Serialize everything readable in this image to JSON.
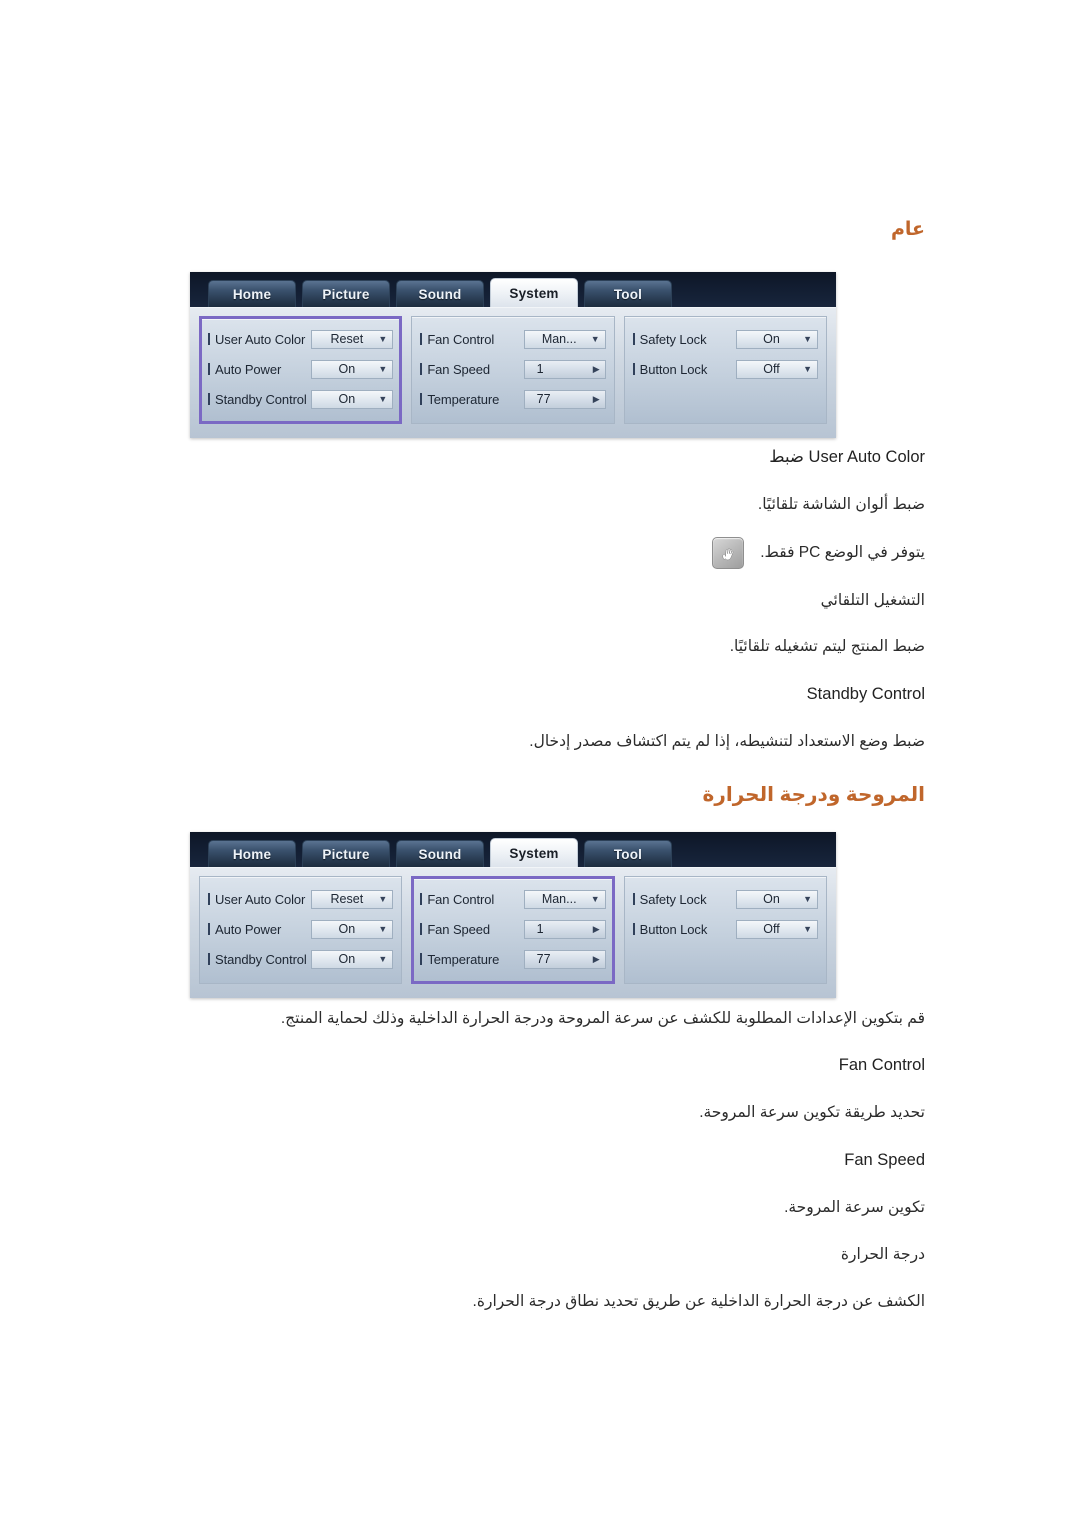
{
  "headings": {
    "general": "عام",
    "fan_temp": "المروحة ودرجة الحرارة"
  },
  "general_section": {
    "item1_title": "ضبط User Auto Color",
    "item1_desc": "ضبط ألوان الشاشة تلقائيًا.",
    "note1": "يتوفر في الوضع PC فقط.",
    "item2_title": "التشغيل التلقائي",
    "item2_desc": "ضبط المنتج ليتم تشغيله تلقائيًا.",
    "item3_title": "Standby Control",
    "item3_desc": "ضبط وضع الاستعداد لتنشيطه، إذا لم يتم اكتشاف مصدر إدخال."
  },
  "fan_section": {
    "intro": "قم بتكوين الإعدادات المطلوبة للكشف عن سرعة المروحة ودرجة الحرارة الداخلية وذلك لحماية المنتج.",
    "item1_title": "Fan Control",
    "item1_desc": "تحديد طريقة تكوين سرعة المروحة.",
    "item2_title": "Fan Speed",
    "item2_desc": "تكوين سرعة المروحة.",
    "item3_title": "درجة الحرارة",
    "item3_desc": "الكشف عن درجة الحرارة الداخلية عن طريق تحديد نطاق درجة الحرارة."
  },
  "osd": {
    "tabs": [
      {
        "label": "Home",
        "active": false
      },
      {
        "label": "Picture",
        "active": false
      },
      {
        "label": "Sound",
        "active": false
      },
      {
        "label": "System",
        "active": true
      },
      {
        "label": "Tool",
        "active": false
      }
    ],
    "columns": [
      {
        "id": "col-general",
        "rows": [
          {
            "label": "User Auto Color",
            "value": "Reset",
            "control": "dropdown"
          },
          {
            "label": "Auto Power",
            "value": "On",
            "control": "dropdown"
          },
          {
            "label": "Standby Control",
            "value": "On",
            "control": "dropdown"
          }
        ]
      },
      {
        "id": "col-fan-temp",
        "rows": [
          {
            "label": "Fan Control",
            "value": "Man...",
            "control": "dropdown"
          },
          {
            "label": "Fan Speed",
            "value": "1",
            "control": "stepper"
          },
          {
            "label": "Temperature",
            "value": "77",
            "control": "stepper"
          }
        ]
      },
      {
        "id": "col-lock",
        "rows": [
          {
            "label": "Safety Lock",
            "value": "On",
            "control": "dropdown"
          },
          {
            "label": "Button Lock",
            "value": "Off",
            "control": "dropdown"
          }
        ]
      }
    ],
    "glyphs": {
      "dropdown": "▼",
      "stepper": "▶"
    },
    "highlight_color": "#7b69c4",
    "screenshot1_highlight": "col-general",
    "screenshot2_highlight": "col-fan-temp"
  },
  "icons": {
    "note": "note-hand-icon"
  },
  "colors": {
    "heading": "#c0662b",
    "highlight": "#7b69c4",
    "tabbar": "#121d31"
  }
}
